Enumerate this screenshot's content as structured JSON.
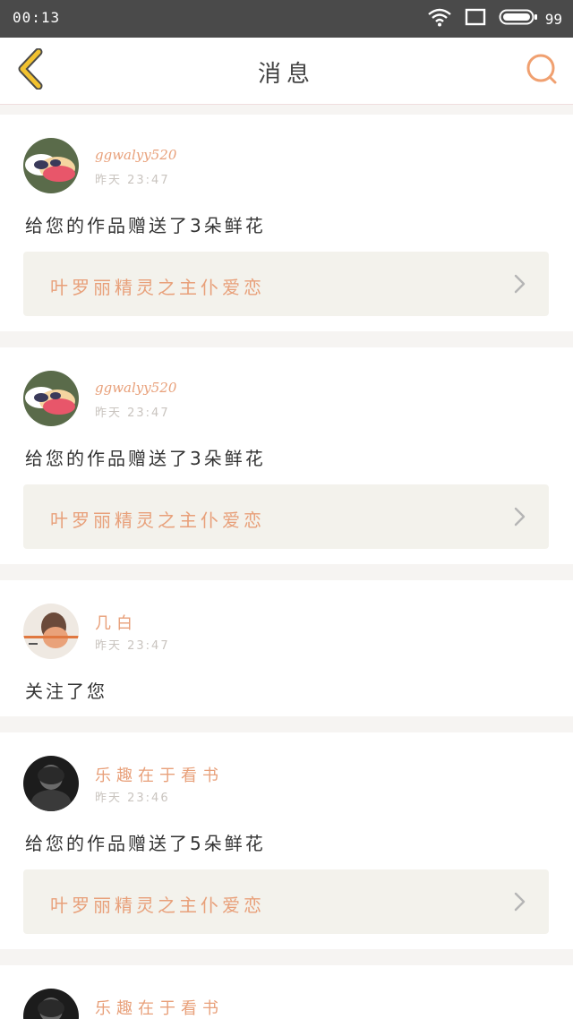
{
  "status_bar": {
    "time": "00:13",
    "battery": "99",
    "icons": [
      "wifi-icon",
      "screen-icon",
      "battery-icon"
    ]
  },
  "header": {
    "title": "消息",
    "back_icon": "chevron-left-icon",
    "search_icon": "search-icon"
  },
  "colors": {
    "accent": "#e8a07a",
    "back_arrow": "#f2c230",
    "status_bar_bg": "#4a4a4a",
    "card_link_bg": "#f3f2ec",
    "page_bg": "#f6f4f2"
  },
  "messages": [
    {
      "username": "ggwalyy520",
      "time": "昨天 23:47",
      "text": "给您的作品赠送了3朵鲜花",
      "work_title": "叶罗丽精灵之主仆爱恋"
    },
    {
      "username": "ggwalyy520",
      "time": "昨天 23:47",
      "text": "给您的作品赠送了3朵鲜花",
      "work_title": "叶罗丽精灵之主仆爱恋"
    },
    {
      "username": "几白",
      "time": "昨天 23:47",
      "text": "关注了您"
    },
    {
      "username": "乐趣在于看书",
      "time": "昨天 23:46",
      "text": "给您的作品赠送了5朵鲜花",
      "work_title": "叶罗丽精灵之主仆爱恋"
    },
    {
      "username": "乐趣在于看书"
    }
  ]
}
